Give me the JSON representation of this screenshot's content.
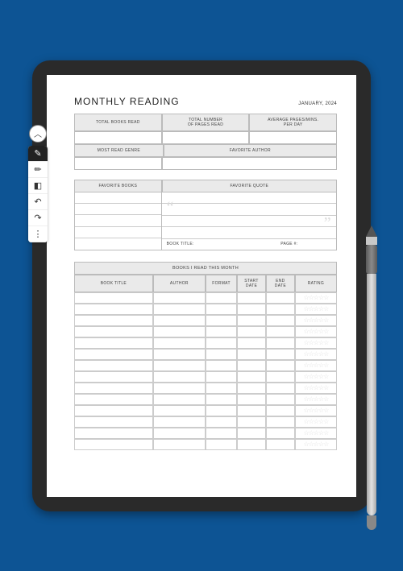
{
  "header": {
    "title": "MONTHLY READING",
    "date": "JANUARY, 2024"
  },
  "stats": {
    "total_books_read": "TOTAL BOOKS READ",
    "total_pages": "TOTAL NUMBER\nOF PAGES READ",
    "avg_per_day": "AVERAGE PAGES/MINS.\nPER DAY",
    "most_read_genre": "MOST READ GENRE",
    "favorite_author": "FAVORITE AUTHOR"
  },
  "favorites": {
    "books_label": "FAVORITE BOOKS",
    "quote_label": "FAVORITE QUOTE",
    "book_title_label": "BOOK TITLE:",
    "page_label": "PAGE #:"
  },
  "books_table": {
    "section_title": "BOOKS I READ THIS MONTH",
    "columns": {
      "title": "BOOK TITLE",
      "author": "AUTHOR",
      "format": "FORMAT",
      "start": "START\nDATE",
      "end": "END\nDATE",
      "rating": "RATING"
    },
    "row_count": 14,
    "star_placeholder": "☆☆☆☆☆"
  },
  "toolbar": {
    "expand": "︿",
    "pen": "✎",
    "highlighter": "✏",
    "eraser": "◧",
    "undo": "↶",
    "redo": "↷",
    "more": "⋮"
  }
}
